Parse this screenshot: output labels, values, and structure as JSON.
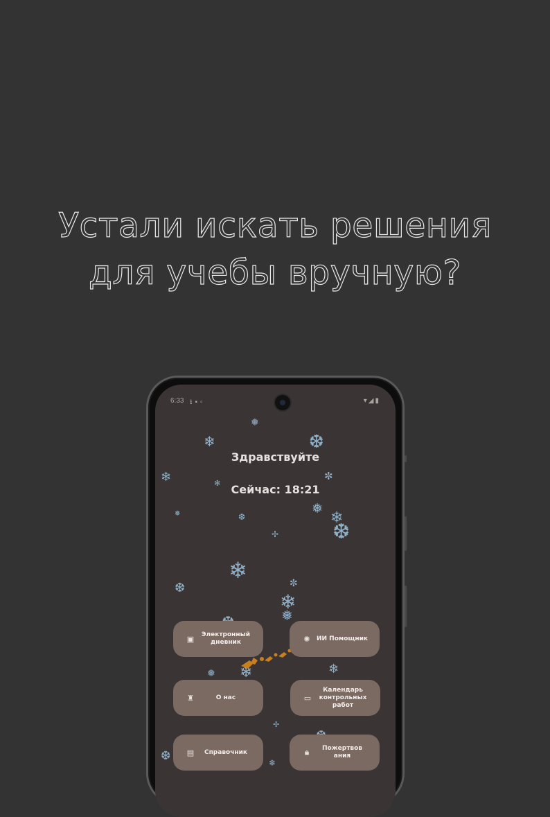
{
  "headline": {
    "line1": "Устали искать решения",
    "line2": "для учебы вручную?"
  },
  "phone": {
    "status_bar": {
      "time": "6:33",
      "left_icons": [
        "download-icon",
        "sim-icon",
        "notification-icon"
      ],
      "right_icons": [
        "wifi-icon",
        "signal-icon",
        "battery-icon"
      ]
    },
    "greeting": "Здравствуйте",
    "clock_text": "Сейчас: 18:21",
    "buttons": [
      {
        "label": "Электронный\nдневник",
        "icon": "diary-icon"
      },
      {
        "label": "ИИ Помощник",
        "icon": "ai-icon"
      },
      {
        "label": "О нас",
        "icon": "about-icon"
      },
      {
        "label": "Календарь\nконтрольных\nработ",
        "icon": "calendar-icon"
      },
      {
        "label": "Справочник",
        "icon": "book-icon"
      },
      {
        "label": "Пожертвов\nания",
        "icon": "lock-icon"
      }
    ],
    "colors": {
      "background": "#3a3534",
      "button": "#7a6a62",
      "snowflake": "#9fc6e2",
      "sleigh": "#c87f1e"
    }
  }
}
